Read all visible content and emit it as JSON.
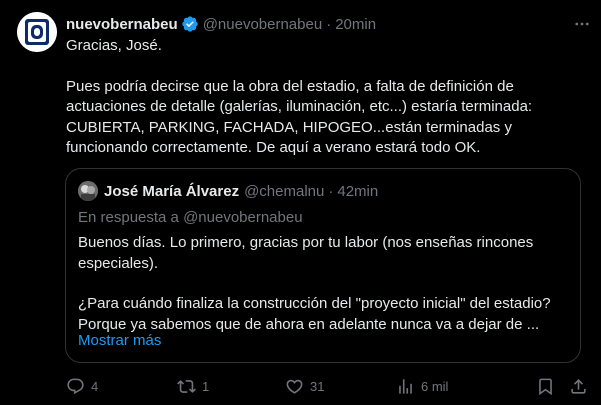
{
  "tweet": {
    "author_name": "nuevobernabeu",
    "author_handle": "@nuevobernabeu",
    "time": "20min",
    "paragraphs": [
      "Gracias, José.",
      "Pues podría decirse que la obra del estadio, a falta de definición de actuaciones de detalle (galerías, iluminación, etc...) estaría terminada: CUBIERTA, PARKING, FACHADA, HIPOGEO...están terminadas y funcionando correctamente. De aquí a verano estará todo OK."
    ]
  },
  "quoted": {
    "author_name": "José María Álvarez",
    "author_handle": "@chemalnu",
    "time": "42min",
    "reply_context": "En respuesta a @nuevobernabeu",
    "paragraphs": [
      "Buenos días. Lo primero, gracias por tu labor (nos enseñas rincones especiales).",
      "¿Para cuándo finaliza la construcción del \"proyecto inicial\" del estadio? Porque ya sabemos que de ahora en adelante nunca va a dejar de ..."
    ],
    "show_more": "Mostrar más"
  },
  "actions": {
    "replies": "4",
    "retweets": "1",
    "likes": "31",
    "views": "6 mil"
  },
  "colors": {
    "background": "#000000",
    "text": "#e7e9ea",
    "muted": "#71767b",
    "link": "#1d9bf0",
    "border": "#2f3336",
    "verified": "#1d9bf0"
  },
  "icons": [
    "more-icon",
    "verified-badge-icon",
    "reply-icon",
    "retweet-icon",
    "like-icon",
    "views-icon",
    "bookmark-icon",
    "share-icon"
  ]
}
